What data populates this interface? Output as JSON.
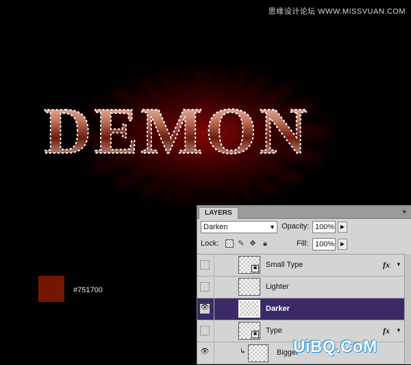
{
  "site_watermark_top": "思缘设计论坛 WWW.MISSVUAN.COM",
  "canvas": {
    "title_text": "DEMON",
    "swatch_color": "#751700",
    "swatch_label": "#751700"
  },
  "panel": {
    "tab_label": "LAYERS",
    "menu_icon": "panel-menu-icon",
    "blend_mode": "Darken",
    "opacity_label": "Opacity:",
    "opacity_value": "100%",
    "lock_label": "Lock:",
    "fill_label": "Fill:",
    "fill_value": "100%"
  },
  "layers": [
    {
      "name": "Small Type",
      "visible": false,
      "selected": false,
      "smart": true,
      "fx": true
    },
    {
      "name": "Lighter",
      "visible": false,
      "selected": false,
      "smart": false,
      "fx": false
    },
    {
      "name": "Darker",
      "visible": true,
      "selected": true,
      "smart": false,
      "fx": false
    },
    {
      "name": "Type",
      "visible": false,
      "selected": false,
      "smart": true,
      "fx": true
    },
    {
      "name": "Bigger",
      "visible": true,
      "selected": false,
      "smart": false,
      "fx": false
    }
  ],
  "watermark_bottom": "UiBQ.CoM",
  "colors": {
    "accent_selected": "#3b2a66",
    "swatch": "#751700",
    "watermark_outline": "#1a8fd8"
  }
}
